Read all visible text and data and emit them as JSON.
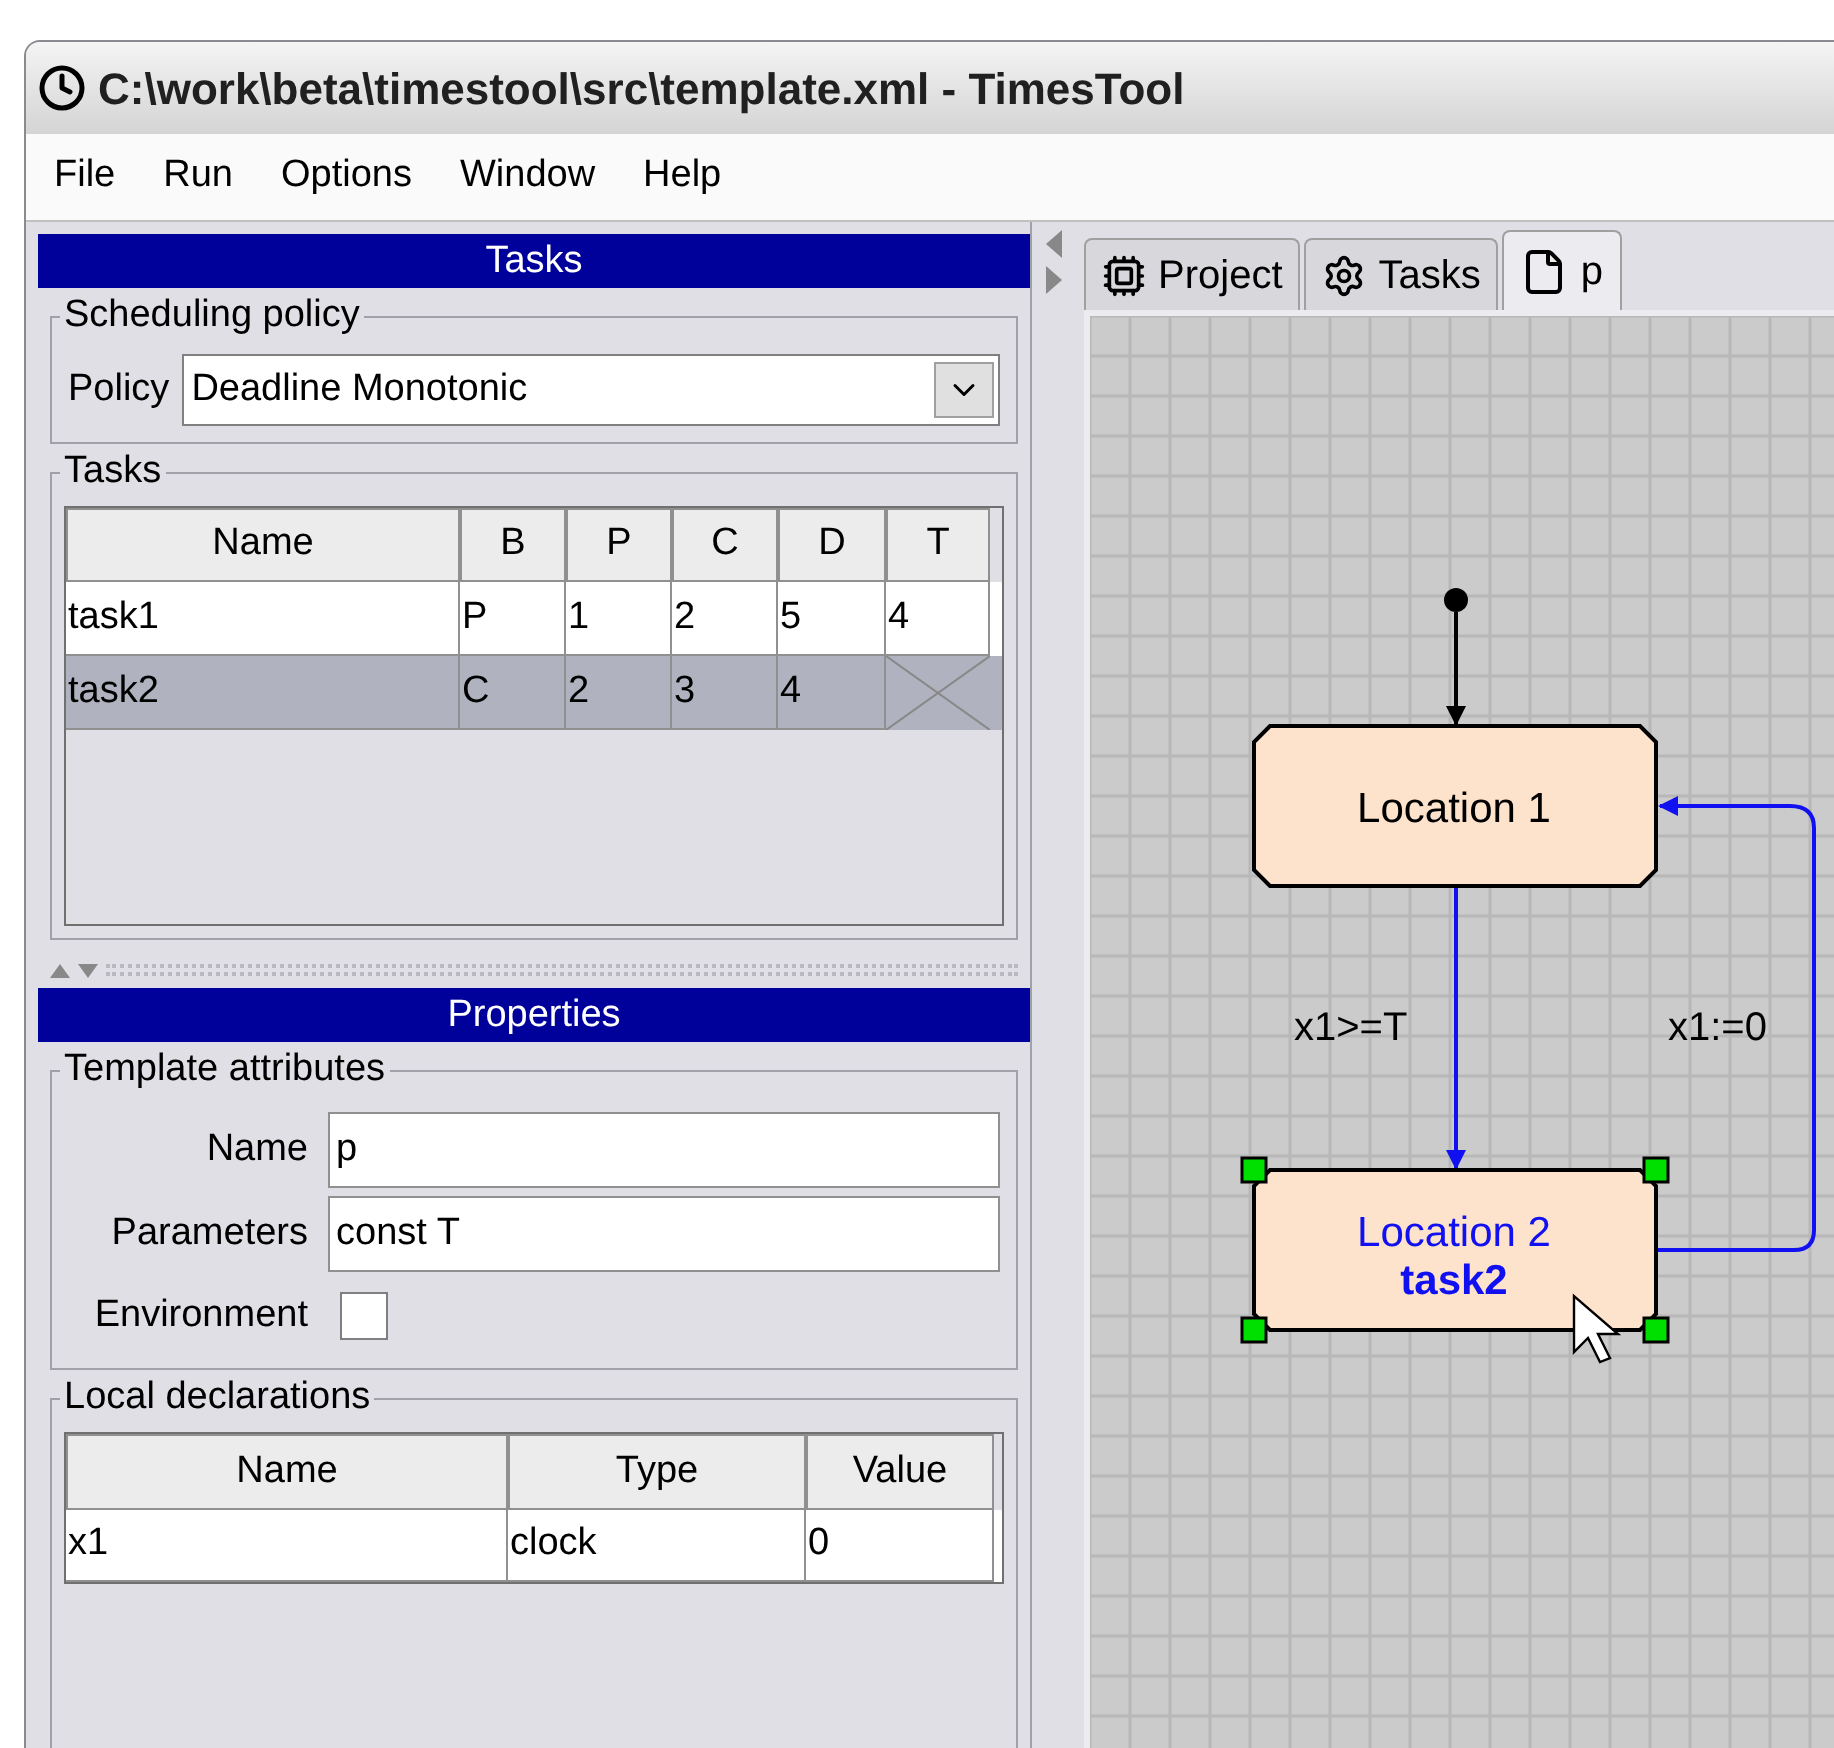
{
  "window": {
    "title": "C:\\work\\beta\\timestool\\src\\template.xml - TimesTool"
  },
  "menu": [
    {
      "label": "File"
    },
    {
      "label": "Run"
    },
    {
      "label": "Options"
    },
    {
      "label": "Window"
    },
    {
      "label": "Help"
    }
  ],
  "tasks_panel": {
    "title": "Tasks",
    "scheduling_group": "Scheduling policy",
    "policy_label": "Policy",
    "policy_value": "Deadline Monotonic",
    "tasks_group": "Tasks",
    "columns": [
      "Name",
      "B",
      "P",
      "C",
      "D",
      "T"
    ],
    "rows": [
      {
        "cells": [
          "task1",
          "P",
          "1",
          "2",
          "5",
          "4"
        ],
        "t_enabled": true,
        "selected": false
      },
      {
        "cells": [
          "task2",
          "C",
          "2",
          "3",
          "4"
        ],
        "t_enabled": false,
        "selected": true
      }
    ]
  },
  "properties_panel": {
    "title": "Properties",
    "attributes_group": "Template attributes",
    "name_label": "Name",
    "name_value": "p",
    "parameters_label": "Parameters",
    "parameters_value": "const T",
    "environment_label": "Environment",
    "environment_checked": false,
    "declarations_group": "Local declarations",
    "columns": [
      "Name",
      "Type",
      "Value"
    ],
    "rows": [
      {
        "cells": [
          "x1",
          "clock",
          "0"
        ]
      }
    ]
  },
  "tabs": [
    {
      "label": "Project",
      "kind": "project",
      "selected": false
    },
    {
      "label": "Tasks",
      "kind": "tasks",
      "selected": false
    },
    {
      "label": "p",
      "kind": "template",
      "selected": true
    }
  ],
  "diagram": {
    "locations": [
      {
        "name": "Location 1",
        "selected": false
      },
      {
        "name": "Location 2",
        "task": "task2",
        "selected": true
      }
    ],
    "edges": [
      {
        "label": "x1>=T"
      },
      {
        "label": "x1:=0"
      }
    ]
  }
}
